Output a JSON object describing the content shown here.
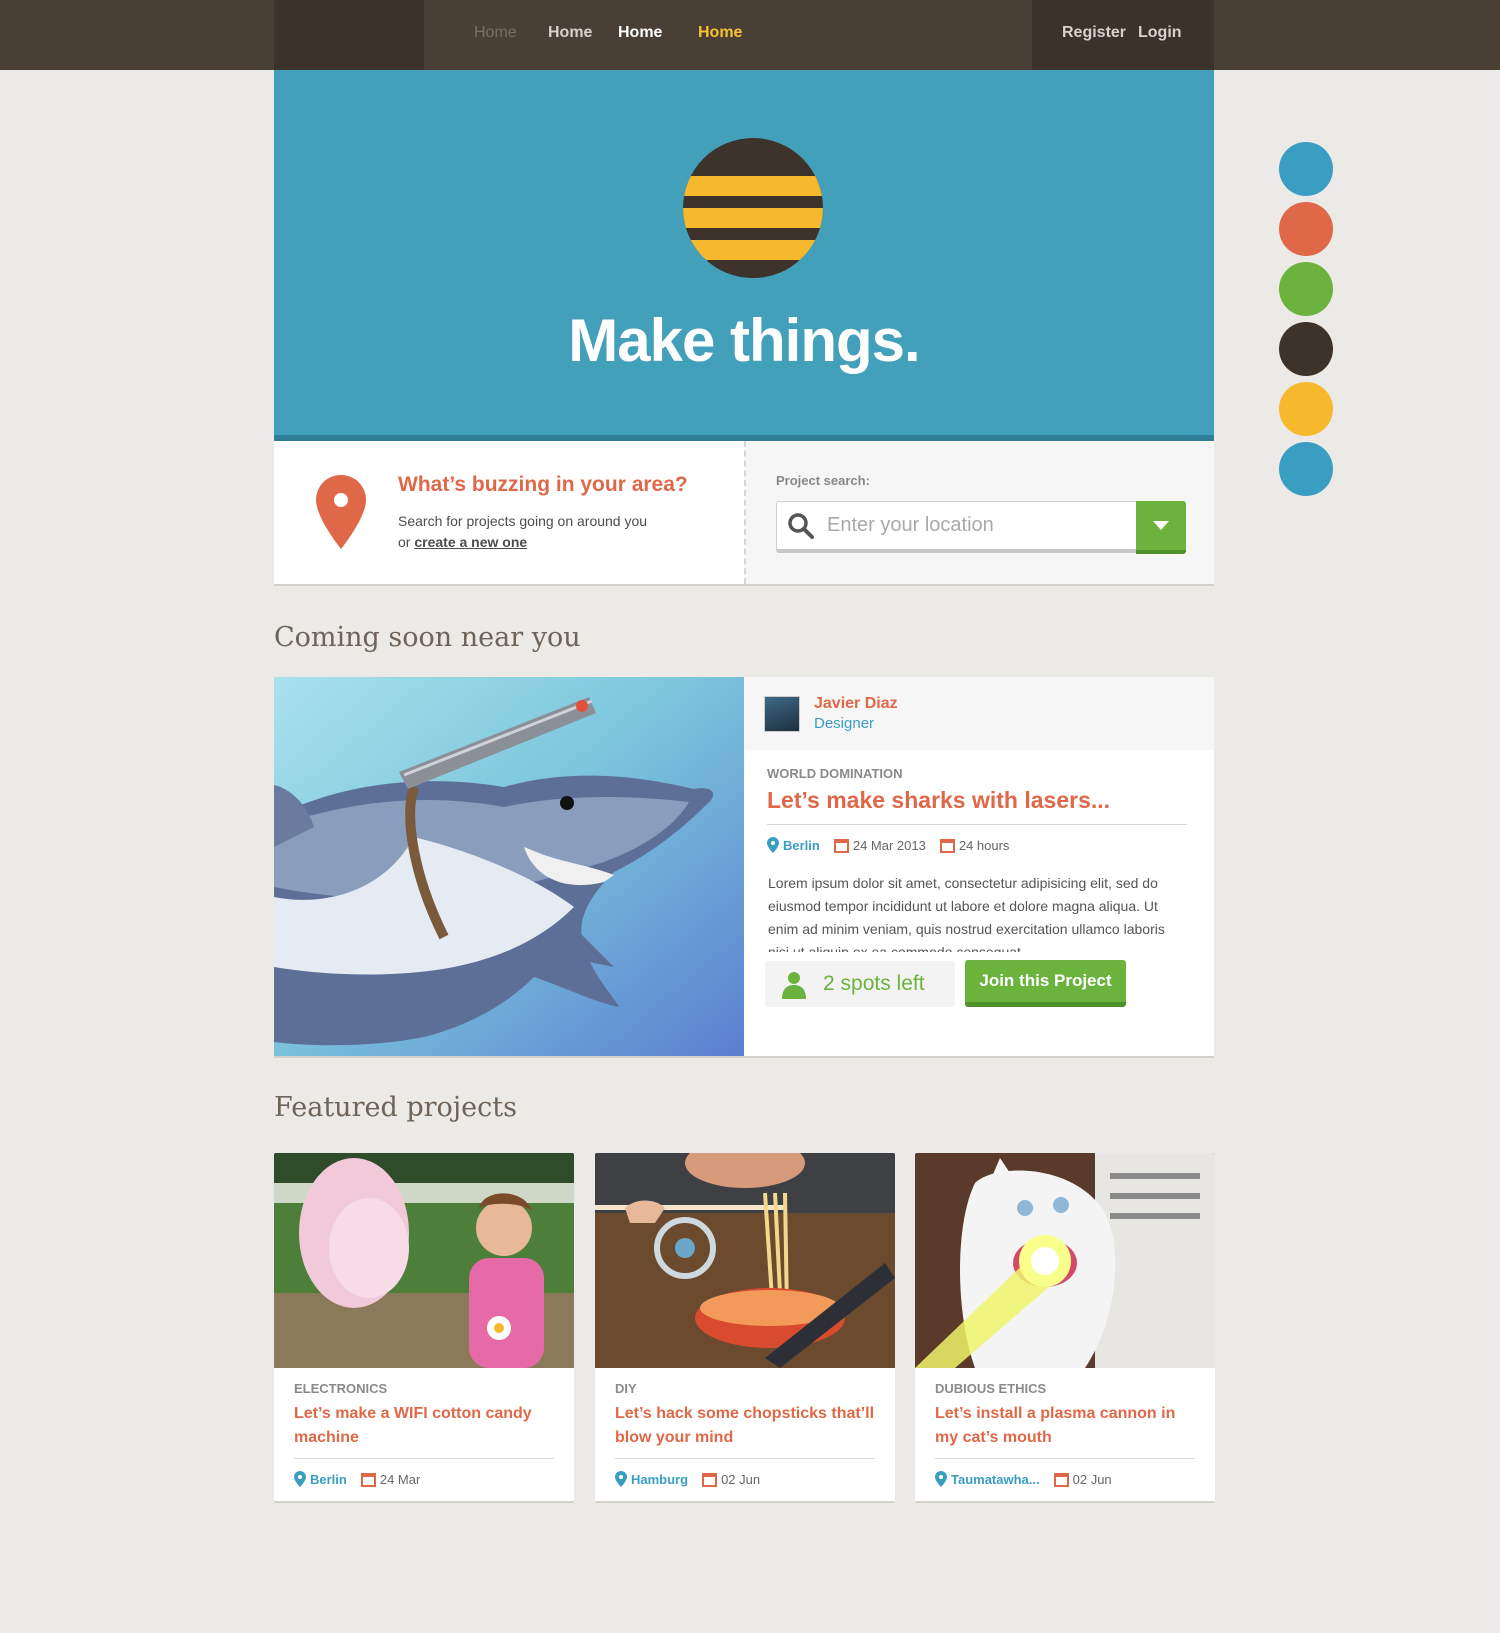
{
  "nav": {
    "links": [
      "Home",
      "Home",
      "Home",
      "Home"
    ],
    "register": "Register",
    "login": "Login"
  },
  "hero": {
    "title": "Make things.",
    "colors": {
      "bg": "#43a0bb",
      "logo_dark": "#3d332b",
      "logo_yellow": "#f6b92e"
    }
  },
  "swatches": [
    "#3a9ec3",
    "#df6848",
    "#6cb33e",
    "#3d332b",
    "#f6b92e",
    "#3a9ec3"
  ],
  "search_panel": {
    "title": "What’s buzzing in your area?",
    "text_before": "Search for projects going on around you or ",
    "link": "create a new one",
    "label": "Project search:",
    "placeholder": "Enter your location"
  },
  "coming_soon": {
    "heading": "Coming soon near you",
    "author_name": "Javier Diaz",
    "author_role": "Designer",
    "category": "WORLD DOMINATION",
    "title": "Let’s make sharks with lasers...",
    "location": "Berlin",
    "date": "24 Mar 2013",
    "duration": "24 hours",
    "description": "Lorem ipsum dolor sit amet, consectetur adipisicing elit, sed do eiusmod tempor incididunt ut labore et dolore magna aliqua. Ut enim ad minim veniam, quis nostrud exercitation ullamco laboris nisi ut aliquip ex ea commodo consequat.",
    "spots": "2 spots left",
    "join_label": "Join this Project"
  },
  "featured": {
    "heading": "Featured projects",
    "cards": [
      {
        "category": "ELECTRONICS",
        "title": "Let’s make a WIFI cotton candy machine",
        "location": "Berlin",
        "date": "24 Mar"
      },
      {
        "category": "DIY",
        "title": "Let’s hack some chopsticks that’ll blow your mind",
        "location": "Hamburg",
        "date": "02 Jun"
      },
      {
        "category": "DUBIOUS ETHICS",
        "title": "Let’s install a plasma cannon in my cat’s mouth",
        "location": "Taumatawha...",
        "date": "02 Jun"
      }
    ]
  }
}
